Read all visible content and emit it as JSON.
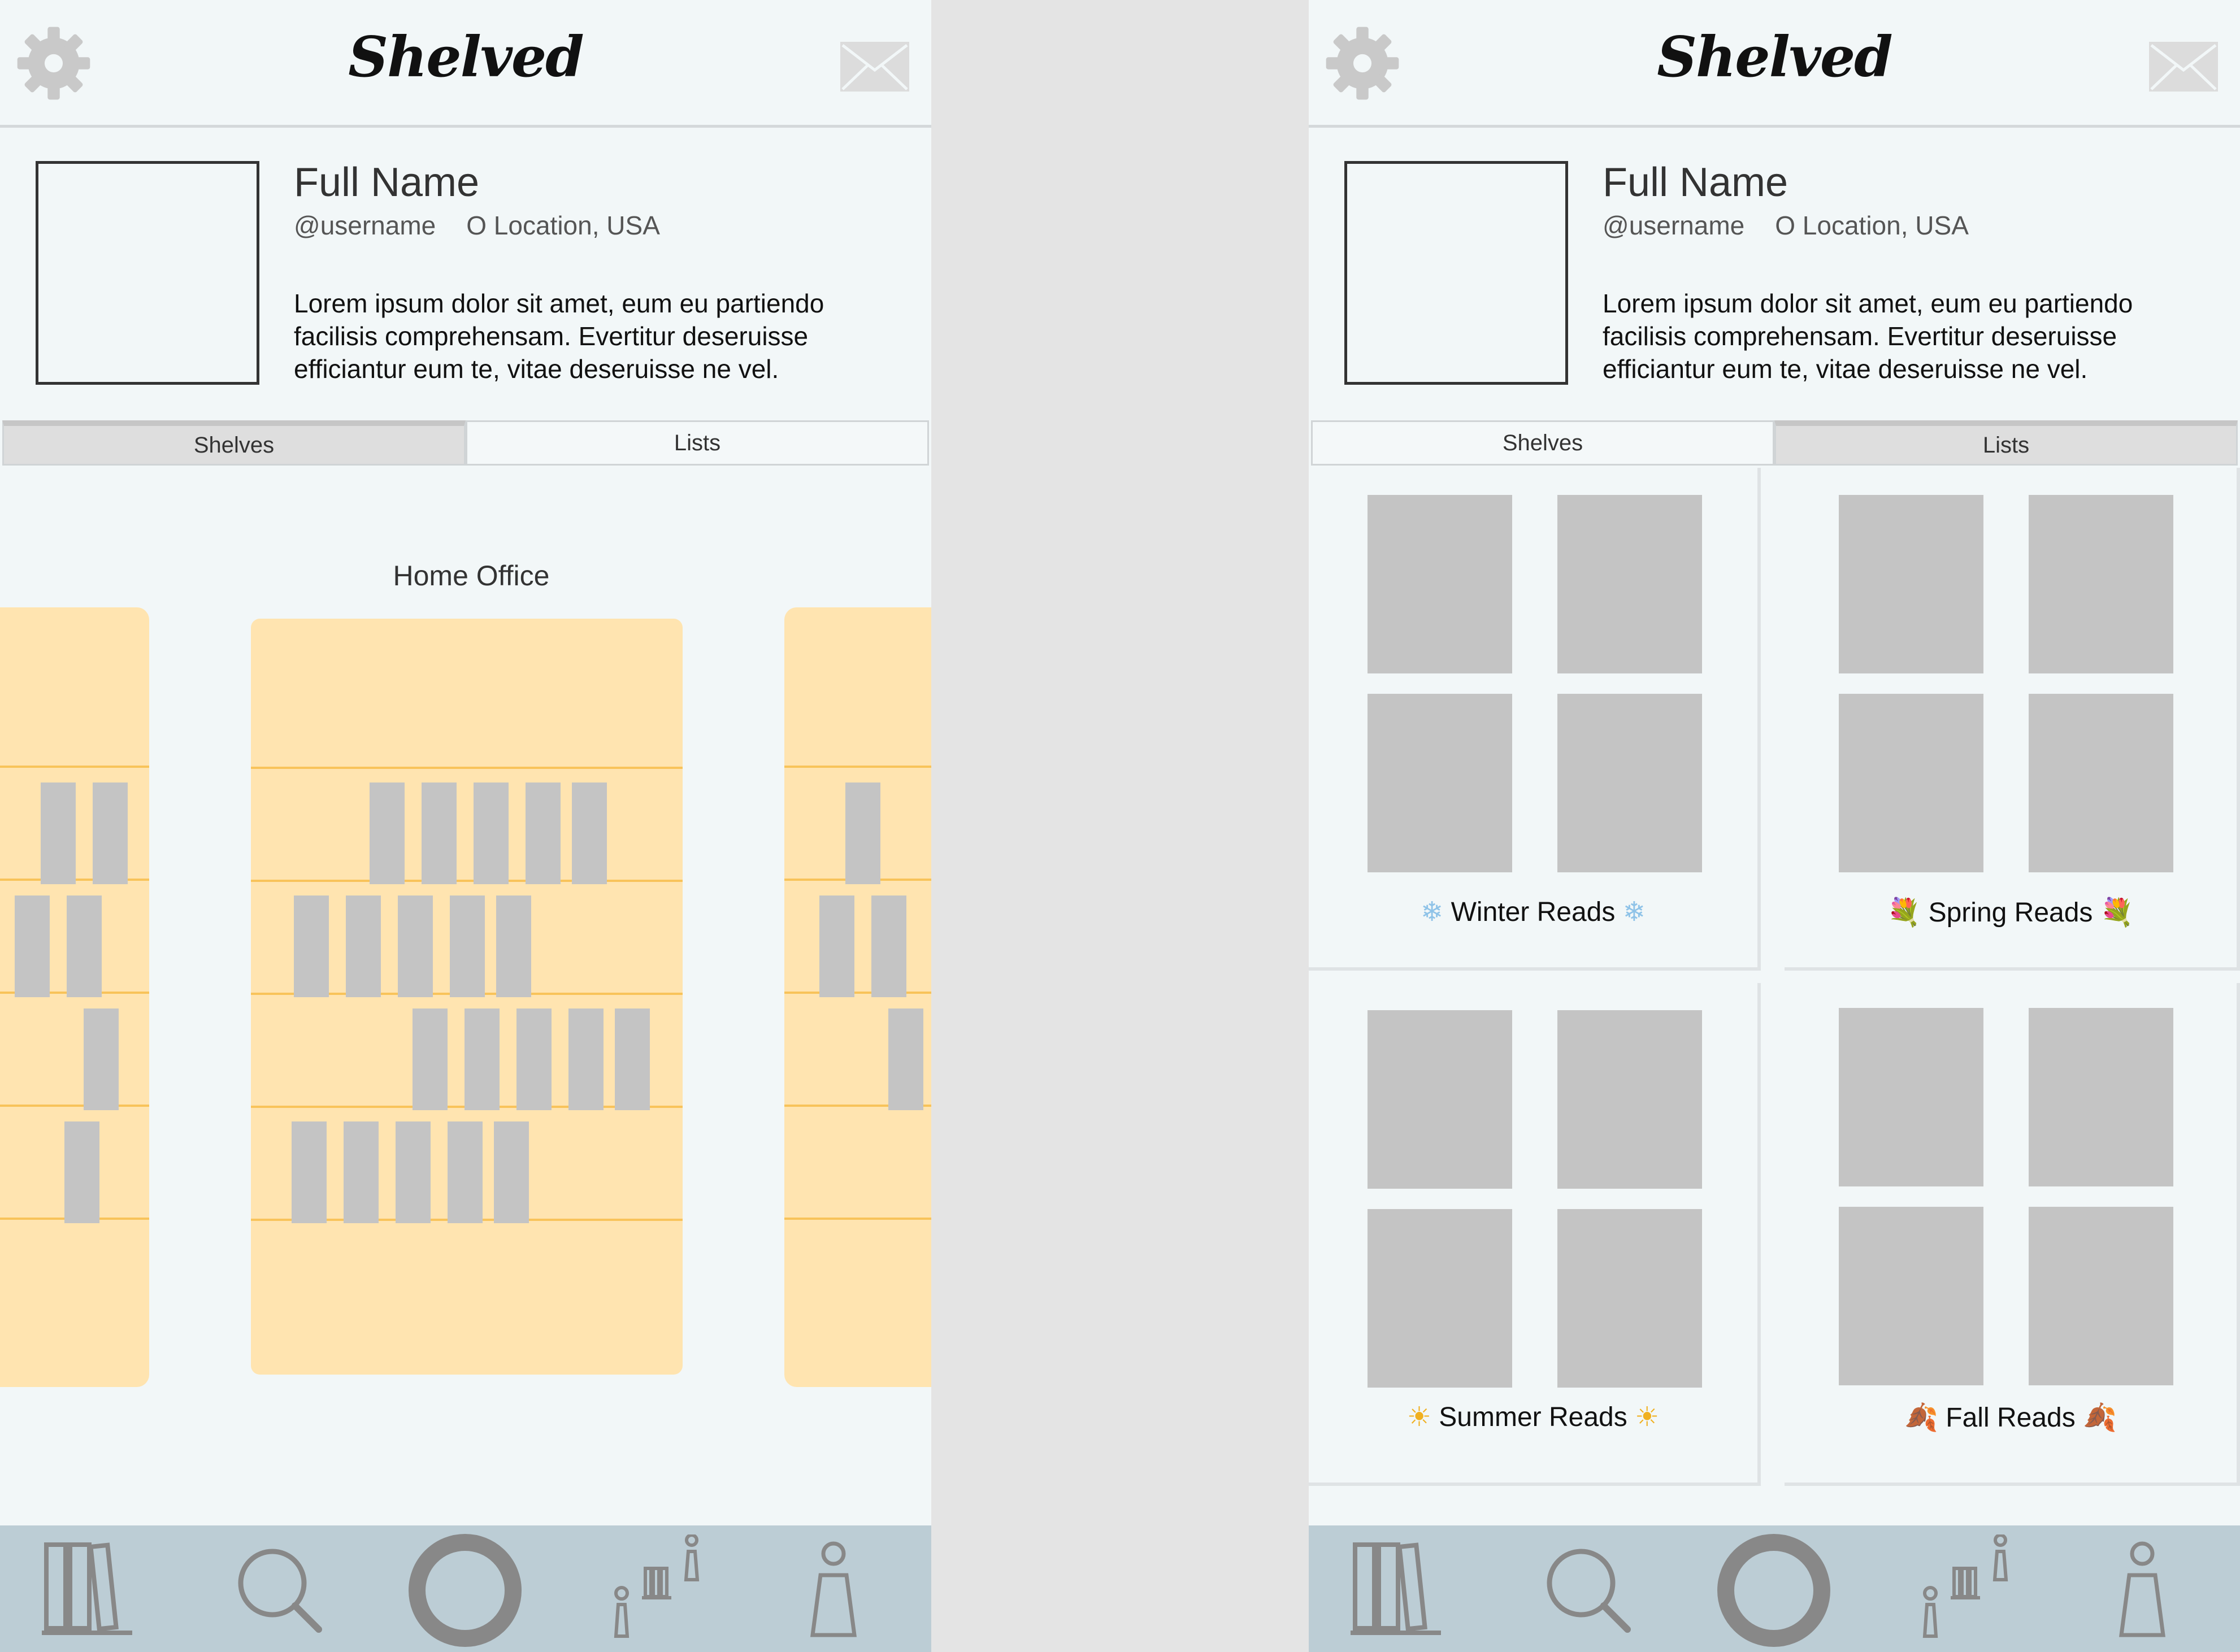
{
  "app": {
    "title": "Shelved",
    "icons": {
      "settings": "gear-icon",
      "messages": "mail-icon"
    }
  },
  "profile": {
    "full_name": "Full Name",
    "username": "@username",
    "location": "O Location, USA",
    "bio": "Lorem ipsum dolor sit amet, eum eu partiendo facilisis comprehensam. Evertitur deseruisse efficiantur eum te, vitae deseruisse ne vel."
  },
  "tabs": {
    "shelves": "Shelves",
    "lists": "Lists"
  },
  "shelves_view": {
    "room_label": "Home Office",
    "active_tab": "Shelves"
  },
  "lists_view": {
    "active_tab": "Lists",
    "lists": [
      {
        "title": "Winter Reads",
        "emoji": "❄"
      },
      {
        "title": "Spring Reads",
        "emoji": "💐"
      },
      {
        "title": "Summer Reads",
        "emoji": "☀"
      },
      {
        "title": "Fall Reads",
        "emoji": "🍂"
      }
    ]
  },
  "bottom_nav": [
    {
      "icon": "library-icon"
    },
    {
      "icon": "search-icon"
    },
    {
      "icon": "home-ring-icon"
    },
    {
      "icon": "community-icon"
    },
    {
      "icon": "profile-icon"
    }
  ],
  "colors": {
    "background": "#f2f7f8",
    "nav_bar": "#bccdd5",
    "shelf": "#ffe4b0",
    "shelf_board": "#f8c35a",
    "book_placeholder": "#c4c4c4"
  }
}
